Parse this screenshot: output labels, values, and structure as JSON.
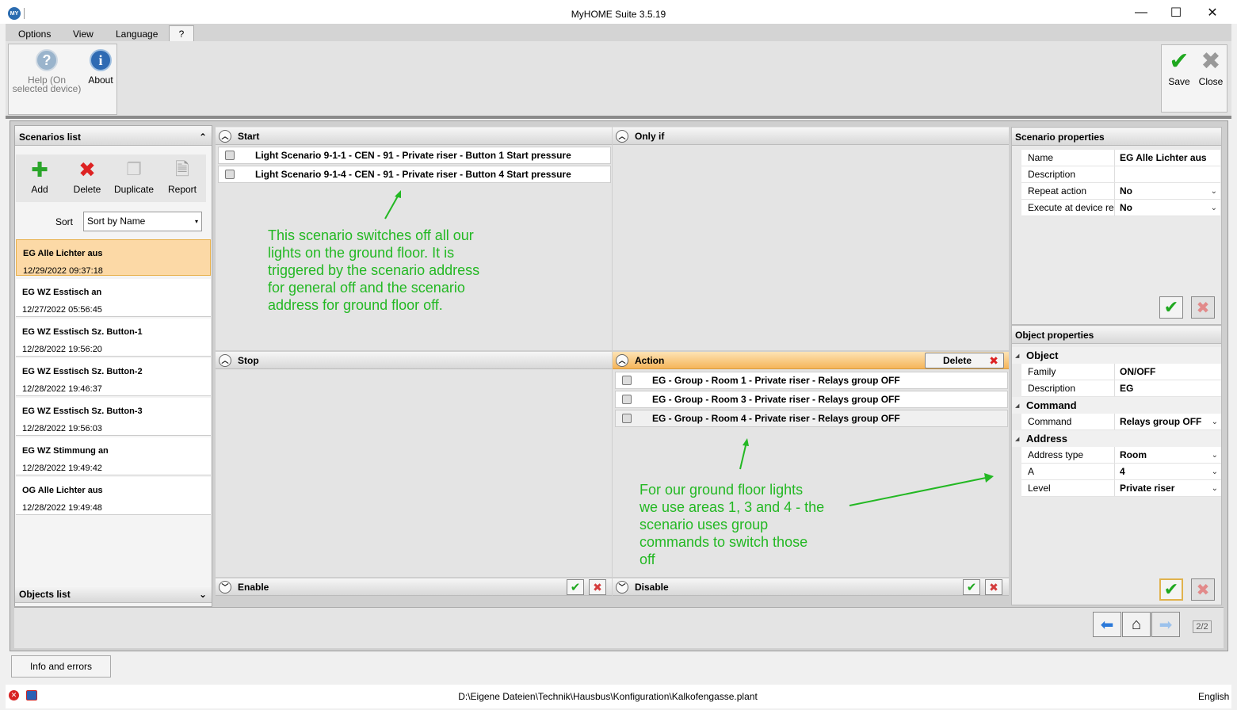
{
  "window": {
    "title": "MyHOME Suite 3.5.19",
    "app_icon": "MY",
    "minimize": "—",
    "maximize": "☐",
    "close": "✕"
  },
  "menu": {
    "options": "Options",
    "view": "View",
    "language": "Language",
    "help": "?"
  },
  "ribbon": {
    "help_label_1": "Help (On",
    "help_label_2": "selected device)",
    "about_label": "About",
    "save_label": "Save",
    "close_label": "Close"
  },
  "scenarios_panel": {
    "title": "Scenarios list",
    "toolbar": {
      "add": "Add",
      "delete": "Delete",
      "duplicate": "Duplicate",
      "report": "Report"
    },
    "sort_label": "Sort",
    "sort_value": "Sort by Name",
    "items": [
      {
        "name": "EG Alle Lichter aus",
        "date": "12/29/2022 09:37:18"
      },
      {
        "name": "EG WZ Esstisch an",
        "date": "12/27/2022 05:56:45"
      },
      {
        "name": "EG WZ Esstisch Sz. Button-1",
        "date": "12/28/2022 19:56:20"
      },
      {
        "name": "EG WZ Esstisch Sz. Button-2",
        "date": "12/28/2022 19:46:37"
      },
      {
        "name": "EG WZ Esstisch Sz. Button-3",
        "date": "12/28/2022 19:56:03"
      },
      {
        "name": "EG WZ Stimmung an",
        "date": "12/28/2022 19:49:42"
      },
      {
        "name": "OG Alle Lichter aus",
        "date": "12/28/2022 19:49:48"
      }
    ],
    "objects_list": "Objects list"
  },
  "start": {
    "title": "Start",
    "rows": [
      "Light Scenario 9-1-1 - CEN - 91 - Private riser - Button 1 Start pressure",
      "Light Scenario 9-1-4 - CEN - 91 - Private riser - Button 4 Start pressure"
    ]
  },
  "only_if": {
    "title": "Only if"
  },
  "stop": {
    "title": "Stop"
  },
  "action": {
    "title": "Action",
    "delete_label": "Delete",
    "rows": [
      "EG - Group - Room 1 - Private riser - Relays group OFF",
      "EG - Group - Room 3 - Private riser - Relays group OFF",
      "EG - Group - Room 4 - Private riser - Relays group OFF"
    ]
  },
  "enable": {
    "title": "Enable"
  },
  "disable": {
    "title": "Disable"
  },
  "annotations": {
    "top": [
      "This scenario switches off all our",
      "lights on the ground floor. It is",
      "triggered by the scenario address",
      "for general off and the scenario",
      "address for ground floor off."
    ],
    "bottom": [
      "For our ground floor lights",
      "we use areas 1, 3 and 4 - the",
      "scenario uses group",
      "commands to switch those",
      "off"
    ]
  },
  "scenario_properties": {
    "title": "Scenario properties",
    "rows": [
      {
        "name": "Name",
        "value": "EG Alle Lichter aus"
      },
      {
        "name": "Description",
        "value": ""
      },
      {
        "name": "Repeat action",
        "value": "No"
      },
      {
        "name": "Execute at device re",
        "value": "No"
      }
    ]
  },
  "object_properties": {
    "title": "Object properties",
    "object_section": "Object",
    "family_label": "Family",
    "family_value": "ON/OFF",
    "desc_label": "Description",
    "desc_value": "EG",
    "command_section": "Command",
    "command_label": "Command",
    "command_value": "Relays group OFF",
    "address_section": "Address",
    "address_type_label": "Address type",
    "address_type_value": "Room",
    "a_label": "A",
    "a_value": "4",
    "level_label": "Level",
    "level_value": "Private riser"
  },
  "navigation": {
    "page": "2/2"
  },
  "info_tab": "Info and errors",
  "status": {
    "path": "D:\\Eigene Dateien\\Technik\\Hausbus\\Konfiguration\\Kalkofengasse.plant",
    "language": "English"
  }
}
